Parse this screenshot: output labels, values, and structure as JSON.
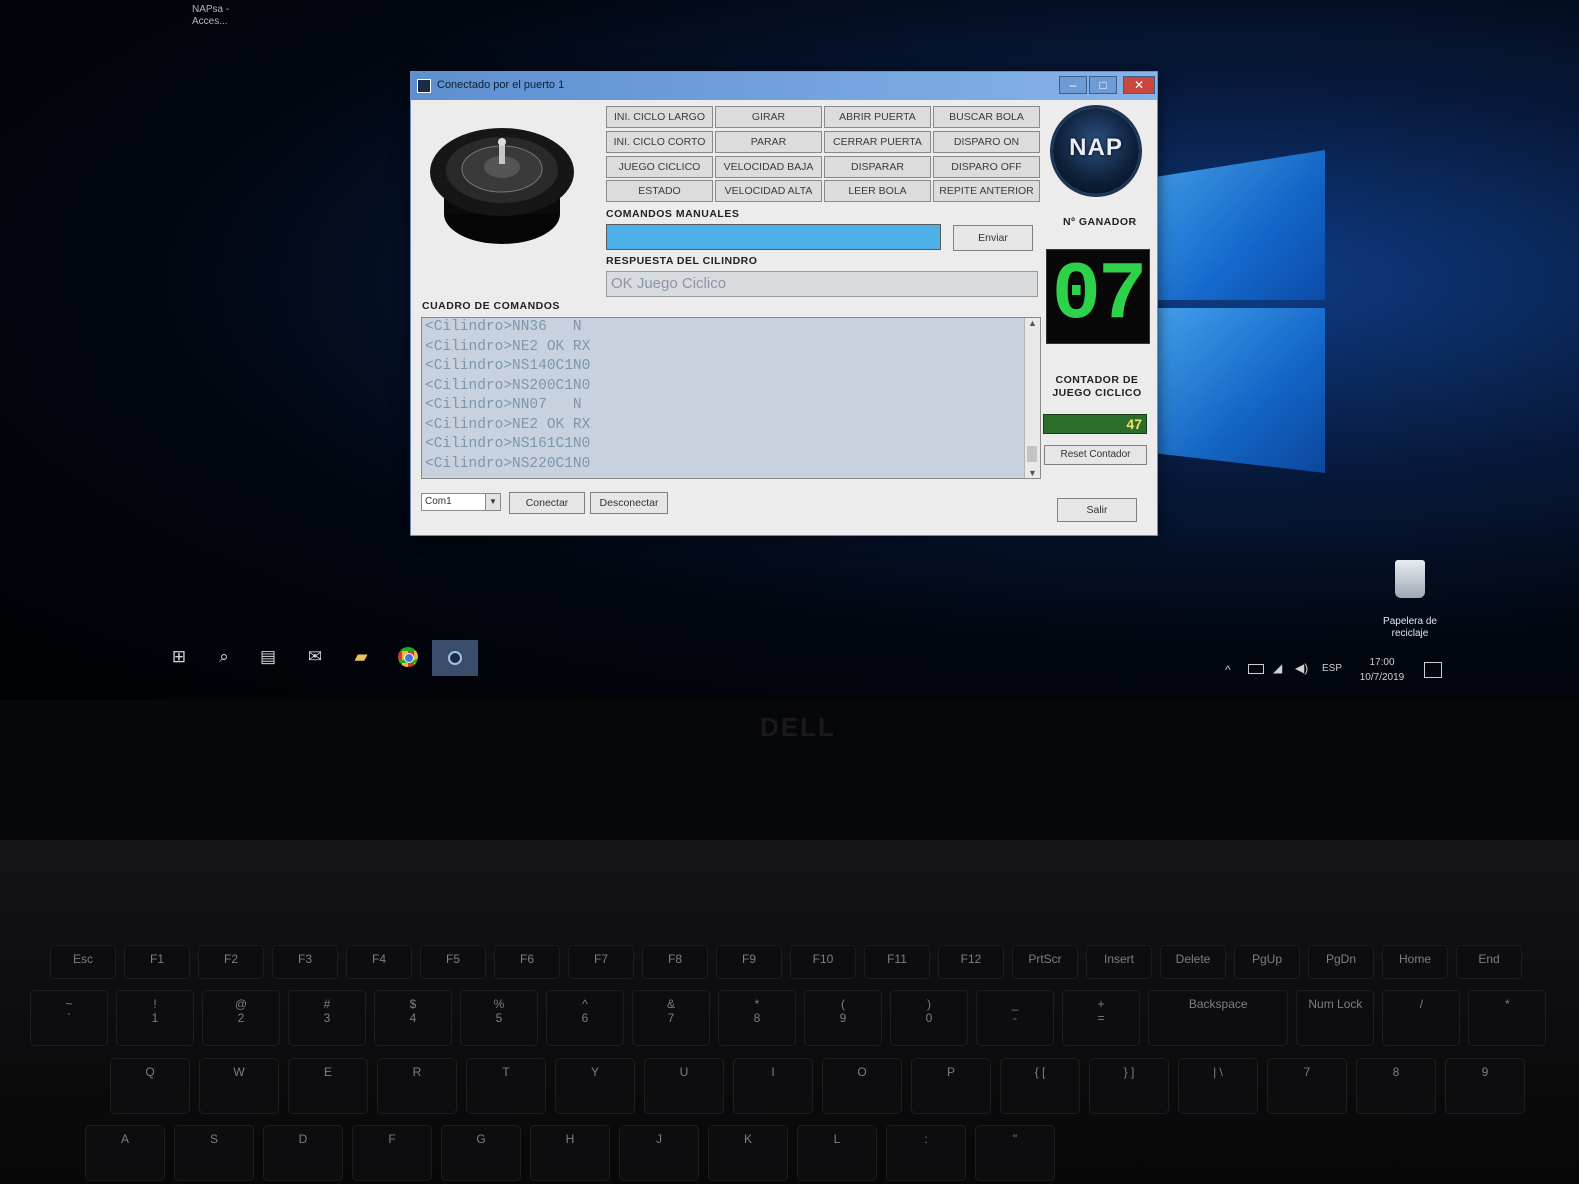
{
  "window": {
    "title": "Conectado por el puerto 1",
    "minimize": "–",
    "maximize": "□",
    "close": "✕"
  },
  "command_buttons": [
    "INI. CICLO LARGO",
    "GIRAR",
    "ABRIR PUERTA",
    "BUSCAR BOLA",
    "INI. CICLO CORTO",
    "PARAR",
    "CERRAR PUERTA",
    "DISPARO ON",
    "JUEGO CICLICO",
    "VELOCIDAD BAJA",
    "DISPARAR",
    "DISPARO OFF",
    "ESTADO",
    "VELOCIDAD ALTA",
    "LEER BOLA",
    "REPITE ANTERIOR"
  ],
  "manual": {
    "label": "COMANDOS MANUALES",
    "value": "",
    "send_label": "Enviar"
  },
  "response": {
    "label": "RESPUESTA DEL CILINDRO",
    "value": "OK Juego Ciclico"
  },
  "log": {
    "label": "CUADRO DE COMANDOS",
    "lines": [
      "<Cilindro>NN36   N",
      "<Cilindro>NE2 OK RX",
      "<Cilindro>NS140C1N0",
      "<Cilindro>NS200C1N0",
      "<Cilindro>NN07   N",
      "<Cilindro>NE2 OK RX",
      "<Cilindro>NS161C1N0",
      "<Cilindro>NS220C1N0"
    ]
  },
  "port": {
    "selected": "Com1",
    "connect_label": "Conectar",
    "disconnect_label": "Desconectar"
  },
  "brand": {
    "logo_text": "NAP"
  },
  "winner": {
    "label": "Nº GANADOR",
    "value": "07"
  },
  "counter": {
    "label_line1": "CONTADOR DE",
    "label_line2": "JUEGO CICLICO",
    "value": "47",
    "reset_label": "Reset Contador"
  },
  "exit_label": "Salir",
  "desktop": {
    "top_icon_line1": "NAPsa -",
    "top_icon_line2": "Acces...",
    "recycle_line1": "Papelera de",
    "recycle_line2": "reciclaje"
  },
  "taskbar": {
    "icons": [
      "windows-start-icon",
      "search-icon",
      "task-view-icon",
      "mail-icon",
      "file-explorer-icon",
      "chrome-icon",
      "nap-app-icon"
    ],
    "language": "ESP",
    "time": "17:00",
    "date": "10/7/2019"
  },
  "laptop_brand": "DELL",
  "keyboard": {
    "fn_row": [
      "Esc",
      "F1",
      "F2",
      "F3",
      "F4",
      "F5",
      "F6",
      "F7",
      "F8",
      "F9",
      "F10",
      "F11",
      "F12",
      "PrtScr",
      "Insert",
      "Delete",
      "PgUp",
      "PgDn",
      "Home",
      "End"
    ],
    "number_row_top": [
      "~",
      "!",
      "@",
      "#",
      "$",
      "%",
      "^",
      "&",
      "*",
      "(",
      ")",
      "_",
      "+",
      "Backspace",
      "Num Lock",
      "/",
      "*"
    ],
    "number_row_bottom": [
      "`",
      "1",
      "2",
      "3",
      "4",
      "5",
      "6",
      "7",
      "8",
      "9",
      "0",
      "-",
      "=",
      "",
      "",
      "",
      ""
    ],
    "qwerty_row": [
      "Q",
      "W",
      "E",
      "R",
      "T",
      "Y",
      "U",
      "I",
      "O",
      "P",
      "{ [",
      "} ]",
      "| \\",
      "7",
      "8",
      "9"
    ],
    "asdf_row": [
      "A",
      "S",
      "D",
      "F",
      "G",
      "H",
      "J",
      "K",
      "L",
      ":",
      "\""
    ]
  },
  "colors": {
    "input_accent": "#4fb0e8",
    "display_digits": "#2dd24a",
    "counter_bg": "#2b6e2b",
    "counter_text": "#f3e16a"
  }
}
